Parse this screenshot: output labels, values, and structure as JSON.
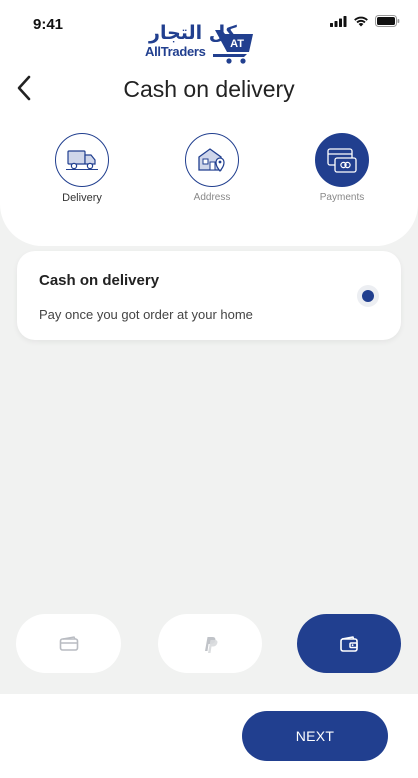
{
  "status_bar": {
    "time": "9:41"
  },
  "logo": {
    "arabic": "كل التجار",
    "english": "AllTraders",
    "badge": "AT"
  },
  "header": {
    "back_icon": "chevron-left-icon",
    "title": "Cash on delivery"
  },
  "steps": [
    {
      "label": "Delivery",
      "icon": "truck-icon",
      "active": false
    },
    {
      "label": "Address",
      "icon": "house-location-icon",
      "active": false
    },
    {
      "label": "Payments",
      "icon": "payment-card-icon",
      "active": true
    }
  ],
  "payment_option": {
    "title": "Cash on delivery",
    "subtitle": "Pay once you got order at your home",
    "selected": true
  },
  "payment_tabs": [
    {
      "icon": "card-icon",
      "active": false
    },
    {
      "icon": "paypal-icon",
      "active": false
    },
    {
      "icon": "wallet-icon",
      "active": true
    }
  ],
  "footer": {
    "next_label": "NEXT"
  },
  "colors": {
    "primary": "#213f8f",
    "background": "#f1f2f1",
    "surface": "#ffffff"
  }
}
